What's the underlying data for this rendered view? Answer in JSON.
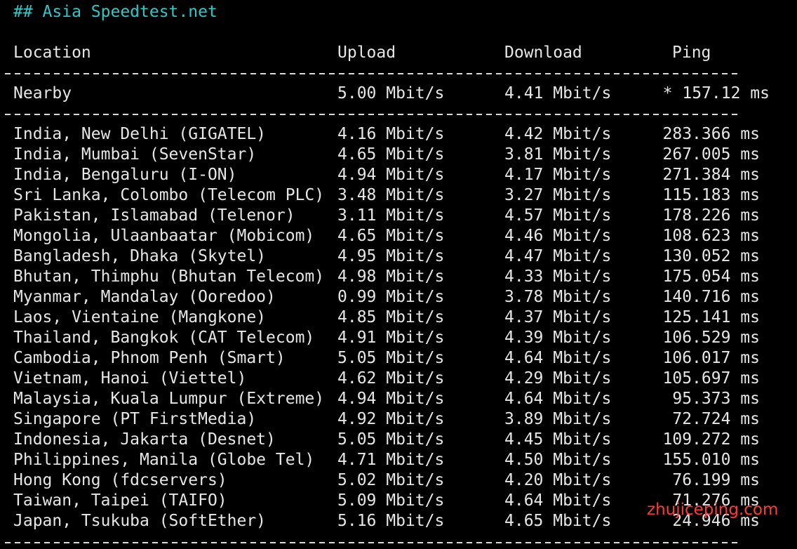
{
  "terminal": {
    "title": "## Asia Speedtest.net",
    "header": {
      "location": "Location",
      "upload": "Upload",
      "download": "Download",
      "ping": "Ping"
    },
    "nearby": {
      "location": "Nearby",
      "upload": "5.00 Mbit/s",
      "download": "4.41 Mbit/s",
      "ping": "* 157.12 ms"
    },
    "rows": [
      {
        "location": "India, New Delhi (GIGATEL)",
        "upload": "4.16 Mbit/s",
        "download": "4.42 Mbit/s",
        "ping": "283.366 ms"
      },
      {
        "location": "India, Mumbai (SevenStar)",
        "upload": "4.65 Mbit/s",
        "download": "3.81 Mbit/s",
        "ping": "267.005 ms"
      },
      {
        "location": "India, Bengaluru (I-ON)",
        "upload": "4.94 Mbit/s",
        "download": "4.17 Mbit/s",
        "ping": "271.384 ms"
      },
      {
        "location": "Sri Lanka, Colombo (Telecom PLC)",
        "upload": "3.48 Mbit/s",
        "download": "3.27 Mbit/s",
        "ping": "115.183 ms"
      },
      {
        "location": "Pakistan, Islamabad (Telenor)",
        "upload": "3.11 Mbit/s",
        "download": "4.57 Mbit/s",
        "ping": "178.226 ms"
      },
      {
        "location": "Mongolia, Ulaanbaatar (Mobicom)",
        "upload": "4.65 Mbit/s",
        "download": "4.46 Mbit/s",
        "ping": "108.623 ms"
      },
      {
        "location": "Bangladesh, Dhaka (Skytel)",
        "upload": "4.95 Mbit/s",
        "download": "4.47 Mbit/s",
        "ping": "130.052 ms"
      },
      {
        "location": "Bhutan, Thimphu (Bhutan Telecom)",
        "upload": "4.98 Mbit/s",
        "download": "4.33 Mbit/s",
        "ping": "175.054 ms"
      },
      {
        "location": "Myanmar, Mandalay (Ooredoo)",
        "upload": "0.99 Mbit/s",
        "download": "3.78 Mbit/s",
        "ping": "140.716 ms"
      },
      {
        "location": "Laos, Vientaine (Mangkone)",
        "upload": "4.85 Mbit/s",
        "download": "4.37 Mbit/s",
        "ping": "125.141 ms"
      },
      {
        "location": "Thailand, Bangkok (CAT Telecom)",
        "upload": "4.91 Mbit/s",
        "download": "4.39 Mbit/s",
        "ping": "106.529 ms"
      },
      {
        "location": "Cambodia, Phnom Penh (Smart)",
        "upload": "5.05 Mbit/s",
        "download": "4.64 Mbit/s",
        "ping": "106.017 ms"
      },
      {
        "location": "Vietnam, Hanoi (Viettel)",
        "upload": "4.62 Mbit/s",
        "download": "4.29 Mbit/s",
        "ping": "105.697 ms"
      },
      {
        "location": "Malaysia, Kuala Lumpur (Extreme)",
        "upload": "4.94 Mbit/s",
        "download": "4.64 Mbit/s",
        "ping": "95.373 ms"
      },
      {
        "location": "Singapore (PT FirstMedia)",
        "upload": "4.92 Mbit/s",
        "download": "3.89 Mbit/s",
        "ping": "72.724 ms"
      },
      {
        "location": "Indonesia, Jakarta (Desnet)",
        "upload": "5.05 Mbit/s",
        "download": "4.45 Mbit/s",
        "ping": "109.272 ms"
      },
      {
        "location": "Philippines, Manila (Globe Tel)",
        "upload": "4.71 Mbit/s",
        "download": "4.50 Mbit/s",
        "ping": "155.010 ms"
      },
      {
        "location": "Hong Kong (fdcservers)",
        "upload": "5.02 Mbit/s",
        "download": "4.20 Mbit/s",
        "ping": "76.199 ms"
      },
      {
        "location": "Taiwan, Taipei (TAIFO)",
        "upload": "5.09 Mbit/s",
        "download": "4.64 Mbit/s",
        "ping": "71.276 ms"
      },
      {
        "location": "Japan, Tsukuba (SoftEther)",
        "upload": "5.16 Mbit/s",
        "download": "4.65 Mbit/s",
        "ping": "24.946 ms"
      }
    ],
    "watermark": "zhujiceping.com"
  },
  "colors": {
    "background": "#000000",
    "text": "#e6e6e6",
    "title": "#2fc7c7",
    "watermark": "#ff3a3a"
  }
}
